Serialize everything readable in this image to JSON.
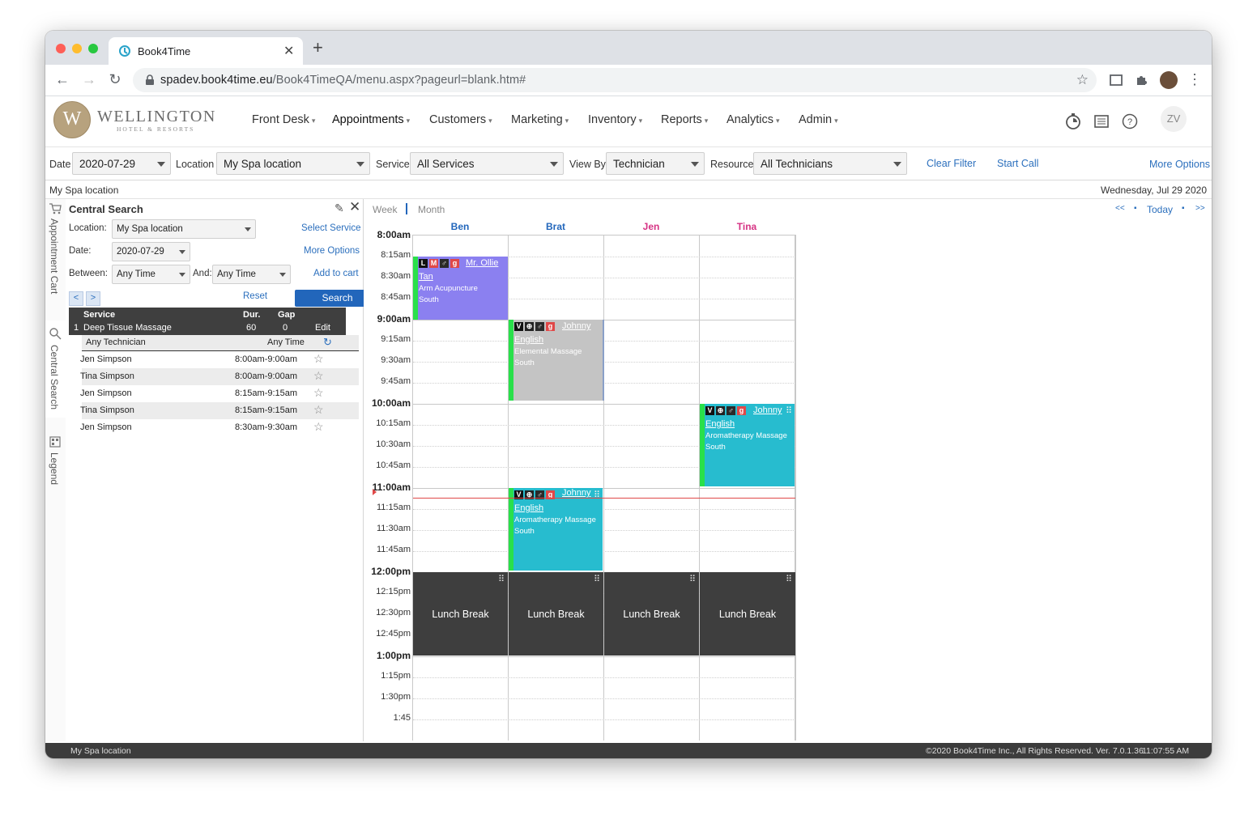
{
  "browser": {
    "tab_title": "Book4Time",
    "url_host": "spadev.book4time.eu",
    "url_path": "/Book4TimeQA/menu.aspx?pageurl=blank.htm#"
  },
  "brand": {
    "name": "WELLINGTON",
    "subtitle": "HOTEL & RESORTS",
    "initial": "W"
  },
  "nav": [
    {
      "label": "Front Desk"
    },
    {
      "label": "Appointments"
    },
    {
      "label": "Customers"
    },
    {
      "label": "Marketing"
    },
    {
      "label": "Inventory"
    },
    {
      "label": "Reports"
    },
    {
      "label": "Analytics"
    },
    {
      "label": "Admin"
    }
  ],
  "user_initials": "ZV",
  "filters": {
    "date_label": "Date",
    "date_value": "2020-07-29",
    "location_label": "Location",
    "location_value": "My Spa location",
    "service_label": "Service",
    "service_value": "All Services",
    "viewby_label": "View By",
    "viewby_value": "Technician",
    "resource_label": "Resource",
    "resource_value": "All Technicians",
    "clear_filter": "Clear Filter",
    "start_call": "Start Call",
    "more_options": "More Options"
  },
  "location_bar": {
    "location": "My Spa location",
    "date": "Wednesday, Jul 29 2020"
  },
  "side_tabs": {
    "cart": "Appointment Cart",
    "search": "Central Search",
    "legend": "Legend"
  },
  "central_search": {
    "title": "Central Search",
    "location_label": "Location:",
    "location_value": "My Spa location",
    "select_service": "Select Service",
    "date_label": "Date:",
    "date_value": "2020-07-29",
    "more_options": "More Options",
    "between_label": "Between:",
    "between_value": "Any Time",
    "and_label": "And:",
    "and_value": "Any Time",
    "add_to_cart": "Add to cart",
    "prev": "<",
    "next": ">",
    "reset": "Reset",
    "search": "Search",
    "table_headers": {
      "service": "Service",
      "dur": "Dur.",
      "gap": "Gap"
    },
    "service_row": {
      "num": "1",
      "name": "Deep Tissue Massage",
      "dur": "60",
      "gap": "0",
      "edit": "Edit"
    },
    "any_technician": "Any Technician",
    "any_time": "Any Time",
    "results": [
      {
        "name": "Jen Simpson",
        "time": "8:00am-9:00am"
      },
      {
        "name": "Tina Simpson",
        "time": "8:00am-9:00am"
      },
      {
        "name": "Jen Simpson",
        "time": "8:15am-9:15am"
      },
      {
        "name": "Tina Simpson",
        "time": "8:15am-9:15am"
      },
      {
        "name": "Jen Simpson",
        "time": "8:30am-9:30am"
      }
    ]
  },
  "calendar": {
    "week": "Week",
    "month": "Month",
    "prev": "<<",
    "today": "Today",
    "next": ">>",
    "technicians": [
      {
        "name": "Ben",
        "color": "#2266bb"
      },
      {
        "name": "Brat",
        "color": "#2266bb"
      },
      {
        "name": "Jen",
        "color": "#d63384"
      },
      {
        "name": "Tina",
        "color": "#d63384"
      }
    ],
    "times": [
      "8:00am",
      "8:15am",
      "8:30am",
      "8:45am",
      "9:00am",
      "9:15am",
      "9:30am",
      "9:45am",
      "10:00am",
      "10:15am",
      "10:30am",
      "10:45am",
      "11:00am",
      "11:15am",
      "11:30am",
      "11:45am",
      "12:00pm",
      "12:15pm",
      "12:30pm",
      "12:45pm",
      "1:00pm",
      "1:15pm",
      "1:30pm",
      "1:45"
    ],
    "appointments": [
      {
        "client_a": "Mr. Ollie",
        "client_b": "Tan",
        "service": "Arm Acupuncture",
        "room": "South",
        "color": "#8b80f0",
        "icons": [
          "L",
          "M",
          "♂",
          "g"
        ]
      },
      {
        "client_a": "Johnny",
        "client_b": "English",
        "service": "Elemental Massage",
        "room": "South",
        "color": "#c4c4c4",
        "icons": [
          "V",
          "⊕",
          "♂",
          "g"
        ]
      },
      {
        "client_a": "Johnny",
        "client_b": "English",
        "service": "Aromatherapy Massage",
        "room": "South",
        "color": "#27bccf",
        "icons": [
          "V",
          "⊕",
          "♂",
          "g"
        ]
      },
      {
        "client_a": "Johnny",
        "client_b": "English",
        "service": "Aromatherapy Massage",
        "room": "South",
        "color": "#27bccf",
        "icons": [
          "V",
          "⊕",
          "♂",
          "g"
        ]
      }
    ],
    "lunch_label": "Lunch Break"
  },
  "footer": {
    "location": "My Spa location",
    "copyright": "©2020 Book4Time Inc., All Rights Reserved. Ver. 7.0.1.36",
    "clock": "11:07:55 AM"
  }
}
